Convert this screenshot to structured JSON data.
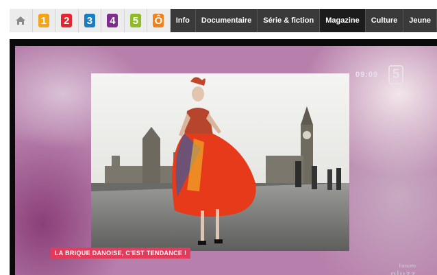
{
  "nav": {
    "home_icon": "home-icon",
    "channels": [
      {
        "label": "1",
        "color": "#f2a51b"
      },
      {
        "label": "2",
        "color": "#e3262f"
      },
      {
        "label": "3",
        "color": "#1a7fc1"
      },
      {
        "label": "4",
        "color": "#7d2d8c"
      },
      {
        "label": "5",
        "color": "#8fbb25"
      },
      {
        "label": "Ô",
        "color": "#f0821e"
      }
    ],
    "menu": [
      "Info",
      "Documentaire",
      "Série & fiction",
      "Magazine",
      "Culture",
      "Jeune"
    ],
    "active": "Magazine"
  },
  "video": {
    "clock": "09:09",
    "channel_logo": "5",
    "caption": "LA BRIQUE DANOISE, C'EST TENDANCE !",
    "brand_small": "francetv",
    "brand_big": "pluzz"
  }
}
